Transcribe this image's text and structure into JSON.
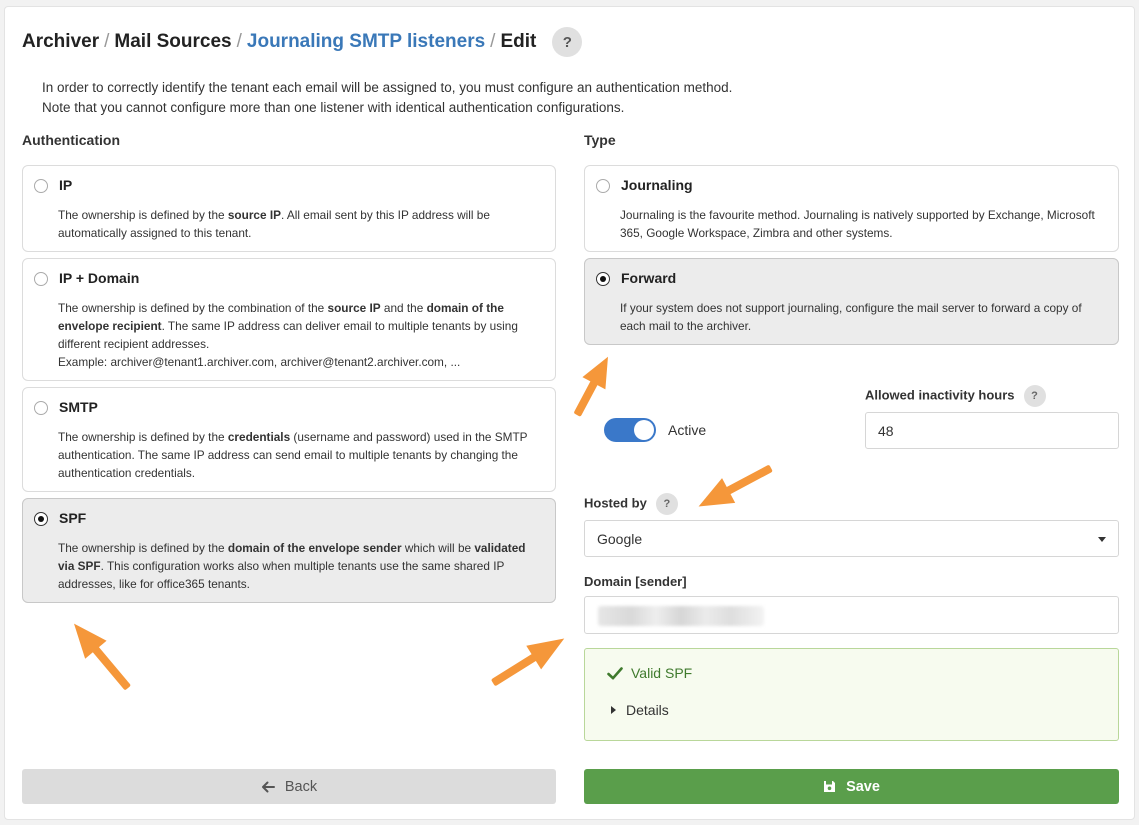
{
  "breadcrumb": {
    "item1": "Archiver",
    "item2": "Mail Sources",
    "item3": "Journaling SMTP listeners",
    "item4": "Edit",
    "separator": "/",
    "help": "?"
  },
  "intro": {
    "line1": "In order to correctly identify the tenant each email will be assigned to, you must configure an authentication method.",
    "line2": "Note that you cannot configure more than one listener with identical authentication configurations."
  },
  "authentication": {
    "label": "Authentication",
    "options": [
      {
        "title": "IP",
        "selected": false,
        "desc": [
          "The ownership is defined by the ",
          "source IP",
          ". All email sent by this IP address will be automatically assigned to this tenant."
        ]
      },
      {
        "title": "IP + Domain",
        "selected": false,
        "desc": [
          "The ownership is defined by the combination of the ",
          "source IP",
          " and the ",
          "domain of the envelope recipient",
          ". The same IP address can deliver email to multiple tenants by using different recipient addresses."
        ],
        "example": "Example: archiver@tenant1.archiver.com, archiver@tenant2.archiver.com, ..."
      },
      {
        "title": "SMTP",
        "selected": false,
        "desc": [
          "The ownership is defined by the ",
          "credentials",
          " (username and password) used in the SMTP authentication. The same IP address can send email to multiple tenants by changing the authentication credentials."
        ]
      },
      {
        "title": "SPF",
        "selected": true,
        "desc": [
          "The ownership is defined by the ",
          "domain of the envelope sender",
          " which will be ",
          "validated via SPF",
          ". This configuration works also when multiple tenants use the same shared IP addresses, like for office365 tenants."
        ]
      }
    ]
  },
  "type": {
    "label": "Type",
    "options": [
      {
        "title": "Journaling",
        "selected": false,
        "desc": "Journaling is the favourite method. Journaling is natively supported by Exchange, Microsoft 365, Google Workspace, Zimbra and other systems."
      },
      {
        "title": "Forward",
        "selected": true,
        "desc": "If your system does not support journaling, configure the mail server to forward a copy of each mail to the archiver."
      }
    ]
  },
  "active": {
    "label": "Active",
    "on": true
  },
  "inactivity": {
    "label": "Allowed inactivity hours",
    "help": "?",
    "value": "48"
  },
  "hosted_by": {
    "label": "Hosted by",
    "help": "?",
    "selected": "Google"
  },
  "domain": {
    "label": "Domain [sender]"
  },
  "validation": {
    "status": "Valid SPF",
    "details": "Details",
    "color": "#3f7a2d"
  },
  "buttons": {
    "back": "Back",
    "save": "Save"
  },
  "colors": {
    "link": "#3a78b8",
    "toggle": "#3a78c9",
    "save": "#5a9e4b",
    "annotation_arrow": "#f5973a"
  },
  "icons": [
    "help-icon",
    "checkmark-icon",
    "disclosure-triangle-icon",
    "dropdown-caret-icon",
    "arrow-left-icon",
    "floppy-disk-icon"
  ]
}
